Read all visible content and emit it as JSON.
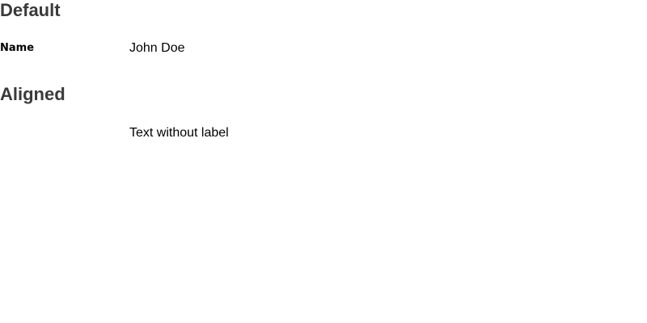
{
  "sections": {
    "default": {
      "title": "Default",
      "field": {
        "label": "Name",
        "value": "John Doe"
      }
    },
    "aligned": {
      "title": "Aligned",
      "field": {
        "value": "Text without label"
      }
    }
  }
}
